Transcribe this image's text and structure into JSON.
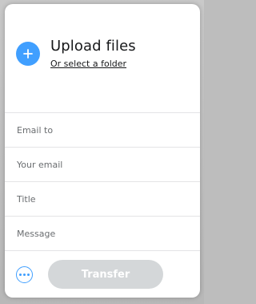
{
  "upload": {
    "title": "Upload files",
    "select_folder": "Or select a folder"
  },
  "form": {
    "email_to_placeholder": "Email to",
    "your_email_placeholder": "Your email",
    "title_placeholder": "Title",
    "message_placeholder": "Message"
  },
  "footer": {
    "transfer_label": "Transfer"
  },
  "colors": {
    "accent": "#409fff",
    "disabled_button": "#d4d7d9"
  },
  "icons": {
    "add": "plus-icon",
    "more": "more-options-icon"
  }
}
